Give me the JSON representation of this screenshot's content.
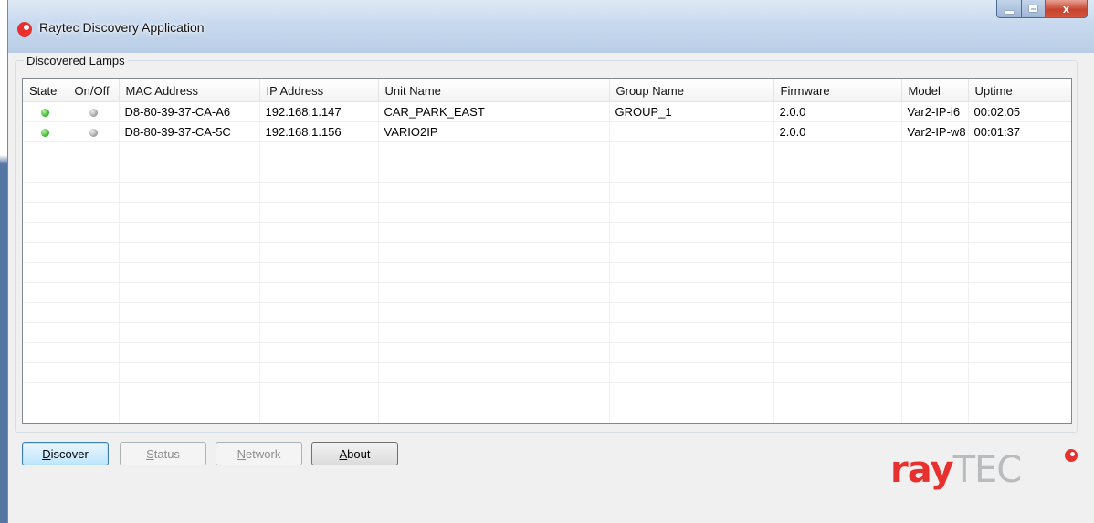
{
  "window": {
    "title": "Raytec Discovery Application"
  },
  "caption_buttons": {
    "minimize": "minimize-icon",
    "maximize": "maximize-icon",
    "close": "close-icon",
    "close_glyph": "x"
  },
  "groupbox": {
    "label": "Discovered Lamps"
  },
  "table": {
    "columns": [
      "State",
      "On/Off",
      "MAC Address",
      "IP Address",
      "Unit Name",
      "Group Name",
      "Firmware",
      "Model",
      "Uptime"
    ],
    "rows": [
      {
        "state": "green",
        "onoff": "grey",
        "mac": "D8-80-39-37-CA-A6",
        "ip": "192.168.1.147",
        "unit": "CAR_PARK_EAST",
        "group": "GROUP_1",
        "firmware": "2.0.0",
        "model": "Var2-IP-i6",
        "uptime": "00:02:05"
      },
      {
        "state": "green",
        "onoff": "grey",
        "mac": "D8-80-39-37-CA-5C",
        "ip": "192.168.1.156",
        "unit": "VARIO2IP",
        "group": "",
        "firmware": "2.0.0",
        "model": "Var2-IP-w8",
        "uptime": "00:01:37"
      }
    ]
  },
  "buttons": {
    "discover": {
      "first": "D",
      "rest": "iscover"
    },
    "status": {
      "first": "S",
      "rest": "tatus"
    },
    "network": {
      "first": "N",
      "rest": "etwork"
    },
    "about": {
      "first": "A",
      "rest": "bout"
    }
  },
  "logo": {
    "ray": "ray",
    "tec": "TEC"
  },
  "colors": {
    "brand_red": "#e8312f",
    "status_green": "#30b12a",
    "status_grey": "#9d9d9d"
  }
}
